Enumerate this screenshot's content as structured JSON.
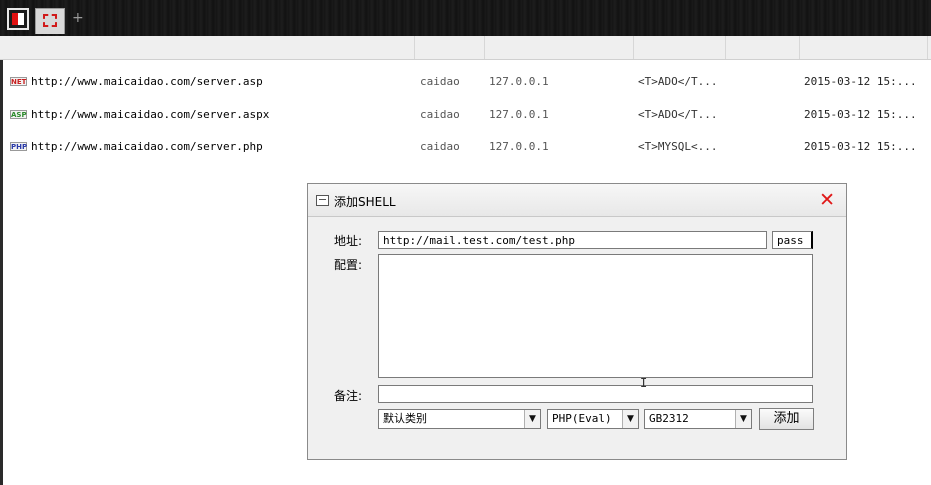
{
  "tabs": {
    "add_label": "+"
  },
  "shells": [
    {
      "type_badge": "NET",
      "badge_color": "#c82020",
      "url": "http://www.maicaidao.com/server.asp",
      "user": "caidao",
      "ip": "127.0.0.1",
      "config": "<T>ADO</T...",
      "time": "2015-03-12 15:..."
    },
    {
      "type_badge": "ASP",
      "badge_color": "#2c8a2c",
      "url": "http://www.maicaidao.com/server.aspx",
      "user": "caidao",
      "ip": "127.0.0.1",
      "config": "<T>ADO</T...",
      "time": "2015-03-12 15:..."
    },
    {
      "type_badge": "PHP",
      "badge_color": "#2a3aa8",
      "url": "http://www.maicaidao.com/server.php",
      "user": "caidao",
      "ip": "127.0.0.1",
      "config": "<T>MYSQL<...",
      "time": "2015-03-12 15:..."
    }
  ],
  "dialog": {
    "title": "添加SHELL",
    "close": "✕",
    "address_label": "地址:",
    "address_value": "http://mail.test.com/test.php",
    "password_value": "pass",
    "config_label": "配置:",
    "config_value": "",
    "note_label": "备注:",
    "note_value": "",
    "category": "默认类别",
    "script_type": "PHP(Eval)",
    "encoding": "GB2312",
    "dropdown_arrow": "▼",
    "add_button": "添加"
  },
  "mouse_cursor": "I"
}
